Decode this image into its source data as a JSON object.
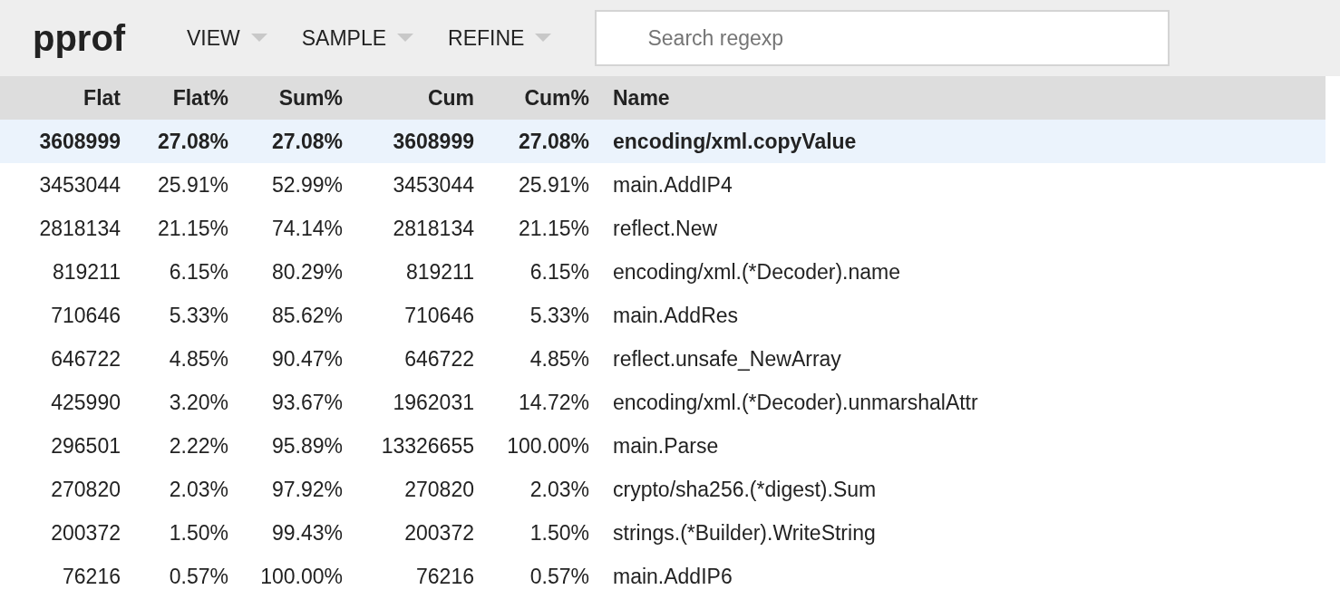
{
  "app_title": "pprof",
  "menus": [
    {
      "label": "VIEW"
    },
    {
      "label": "SAMPLE"
    },
    {
      "label": "REFINE"
    }
  ],
  "search": {
    "placeholder": "Search regexp"
  },
  "table": {
    "columns": [
      "Flat",
      "Flat%",
      "Sum%",
      "Cum",
      "Cum%",
      "Name"
    ],
    "rows": [
      {
        "selected": true,
        "cells": [
          "3608999",
          "27.08%",
          "27.08%",
          "3608999",
          "27.08%",
          "encoding/xml.copyValue"
        ]
      },
      {
        "selected": false,
        "cells": [
          "3453044",
          "25.91%",
          "52.99%",
          "3453044",
          "25.91%",
          "main.AddIP4"
        ]
      },
      {
        "selected": false,
        "cells": [
          "2818134",
          "21.15%",
          "74.14%",
          "2818134",
          "21.15%",
          "reflect.New"
        ]
      },
      {
        "selected": false,
        "cells": [
          "819211",
          "6.15%",
          "80.29%",
          "819211",
          "6.15%",
          "encoding/xml.(*Decoder).name"
        ]
      },
      {
        "selected": false,
        "cells": [
          "710646",
          "5.33%",
          "85.62%",
          "710646",
          "5.33%",
          "main.AddRes"
        ]
      },
      {
        "selected": false,
        "cells": [
          "646722",
          "4.85%",
          "90.47%",
          "646722",
          "4.85%",
          "reflect.unsafe_NewArray"
        ]
      },
      {
        "selected": false,
        "cells": [
          "425990",
          "3.20%",
          "93.67%",
          "1962031",
          "14.72%",
          "encoding/xml.(*Decoder).unmarshalAttr"
        ]
      },
      {
        "selected": false,
        "cells": [
          "296501",
          "2.22%",
          "95.89%",
          "13326655",
          "100.00%",
          "main.Parse"
        ]
      },
      {
        "selected": false,
        "cells": [
          "270820",
          "2.03%",
          "97.92%",
          "270820",
          "2.03%",
          "crypto/sha256.(*digest).Sum"
        ]
      },
      {
        "selected": false,
        "cells": [
          "200372",
          "1.50%",
          "99.43%",
          "200372",
          "1.50%",
          "strings.(*Builder).WriteString"
        ]
      },
      {
        "selected": false,
        "cells": [
          "76216",
          "0.57%",
          "100.00%",
          "76216",
          "0.57%",
          "main.AddIP6"
        ]
      }
    ]
  }
}
